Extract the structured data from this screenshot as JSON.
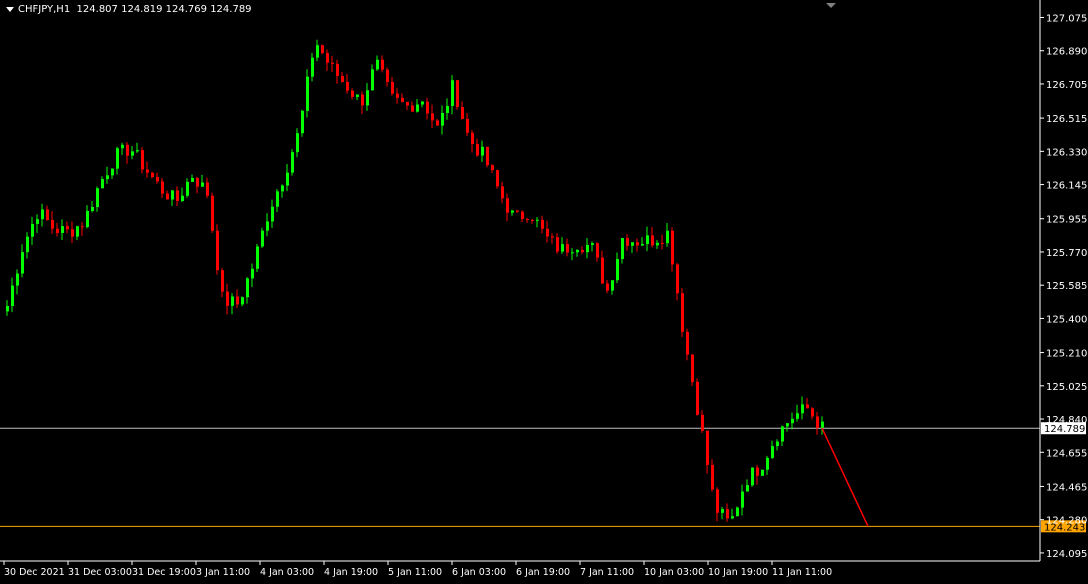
{
  "header": {
    "symbol": "CHFJPY,H1",
    "open": "124.807",
    "high": "124.819",
    "low": "124.769",
    "close": "124.789"
  },
  "colors": {
    "background": "#000000",
    "bull": "#00ff00",
    "bear": "#ff0000",
    "axis": "#ffffff",
    "bid_line": "#c0c0c0",
    "level_line": "#ffa500",
    "level_tag": "#ffa500",
    "projection": "#ff0000"
  },
  "chart_data": {
    "type": "candlestick",
    "title": "CHFJPY,H1",
    "ylim": [
      124.05,
      127.15
    ],
    "y_ticks": [
      "127.075",
      "126.890",
      "126.705",
      "126.515",
      "126.330",
      "126.145",
      "125.955",
      "125.770",
      "125.585",
      "125.400",
      "125.210",
      "125.025",
      "124.840",
      "124.655",
      "124.465",
      "124.280",
      "124.095"
    ],
    "x_ticks": [
      "30 Dec 2021",
      "31 Dec 03:00",
      "31 Dec 19:00",
      "3 Jan 11:00",
      "4 Jan 03:00",
      "4 Jan 19:00",
      "5 Jan 11:00",
      "6 Jan 03:00",
      "6 Jan 19:00",
      "7 Jan 11:00",
      "10 Jan 03:00",
      "10 Jan 19:00",
      "11 Jan 11:00"
    ],
    "grid": false,
    "current_price": "124.789",
    "level_price": "124.243",
    "close_path": [
      125.47,
      125.8,
      126.0,
      125.9,
      125.88,
      125.94,
      126.15,
      126.3,
      126.35,
      126.23,
      126.12,
      126.05,
      126.2,
      126.1,
      125.5,
      125.48,
      125.7,
      126.0,
      126.2,
      126.45,
      126.95,
      126.8,
      126.7,
      126.6,
      126.82,
      126.62,
      126.58,
      126.62,
      126.45,
      126.7,
      126.4,
      126.3,
      126.1,
      125.95,
      126.0,
      125.85,
      125.78,
      125.82,
      125.8,
      125.55,
      125.85,
      125.83,
      125.84,
      125.88,
      125.3,
      124.85,
      124.35,
      124.25,
      124.5,
      124.58,
      124.75,
      124.85,
      124.9,
      124.79
    ],
    "projection": [
      124.79,
      124.243
    ]
  }
}
